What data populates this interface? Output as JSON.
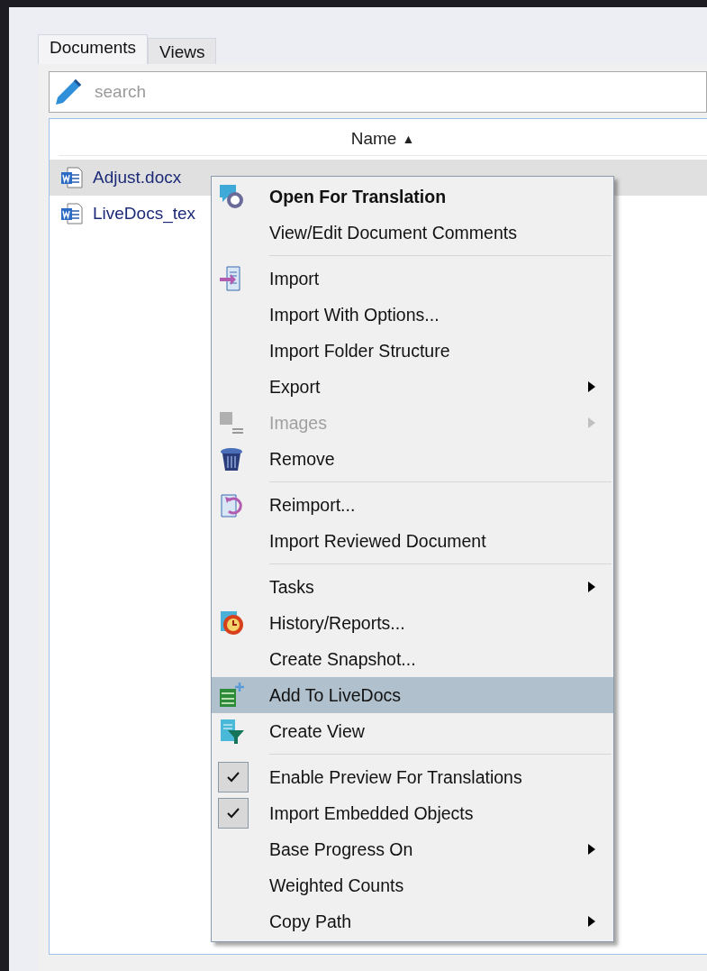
{
  "tabs": [
    {
      "label": "Documents",
      "selected": true
    },
    {
      "label": "Views",
      "selected": false
    }
  ],
  "search": {
    "placeholder": "search"
  },
  "table": {
    "columns": [
      {
        "label": "Name",
        "sort_glyph": "▲"
      }
    ],
    "rows": [
      {
        "name": "Adjust.docx",
        "selected": true
      },
      {
        "name": "LiveDocs_tex",
        "selected": false
      }
    ]
  },
  "context_menu": {
    "groups": [
      {
        "items": [
          {
            "label": "Open For Translation",
            "kind": "translate",
            "bold": true,
            "disabled": false,
            "submenu": false,
            "checked": false,
            "selected": false
          },
          {
            "label": "View/Edit Document Comments",
            "kind": "plain",
            "bold": false,
            "disabled": false,
            "submenu": false,
            "checked": false,
            "selected": false
          }
        ]
      },
      {
        "items": [
          {
            "label": "Import",
            "kind": "import",
            "bold": false,
            "disabled": false,
            "submenu": false,
            "checked": false,
            "selected": false
          },
          {
            "label": "Import With Options...",
            "kind": "plain",
            "bold": false,
            "disabled": false,
            "submenu": false,
            "checked": false,
            "selected": false
          },
          {
            "label": "Import Folder Structure",
            "kind": "plain",
            "bold": false,
            "disabled": false,
            "submenu": false,
            "checked": false,
            "selected": false
          },
          {
            "label": "Export",
            "kind": "plain",
            "bold": false,
            "disabled": false,
            "submenu": true,
            "checked": false,
            "selected": false
          },
          {
            "label": "Images",
            "kind": "images",
            "bold": false,
            "disabled": true,
            "submenu": true,
            "checked": false,
            "selected": false
          },
          {
            "label": "Remove",
            "kind": "remove",
            "bold": false,
            "disabled": false,
            "submenu": false,
            "checked": false,
            "selected": false
          }
        ]
      },
      {
        "items": [
          {
            "label": "Reimport...",
            "kind": "reimport",
            "bold": false,
            "disabled": false,
            "submenu": false,
            "checked": false,
            "selected": false
          },
          {
            "label": "Import Reviewed Document",
            "kind": "plain",
            "bold": false,
            "disabled": false,
            "submenu": false,
            "checked": false,
            "selected": false
          }
        ]
      },
      {
        "items": [
          {
            "label": "Tasks",
            "kind": "plain",
            "bold": false,
            "disabled": false,
            "submenu": true,
            "checked": false,
            "selected": false
          },
          {
            "label": "History/Reports...",
            "kind": "history",
            "bold": false,
            "disabled": false,
            "submenu": false,
            "checked": false,
            "selected": false
          },
          {
            "label": "Create Snapshot...",
            "kind": "plain",
            "bold": false,
            "disabled": false,
            "submenu": false,
            "checked": false,
            "selected": false
          },
          {
            "label": "Add To LiveDocs",
            "kind": "livedocs",
            "bold": false,
            "disabled": false,
            "submenu": false,
            "checked": false,
            "selected": true
          },
          {
            "label": "Create View",
            "kind": "view",
            "bold": false,
            "disabled": false,
            "submenu": false,
            "checked": false,
            "selected": false
          }
        ]
      },
      {
        "items": [
          {
            "label": "Enable Preview For Translations",
            "kind": "check",
            "bold": false,
            "disabled": false,
            "submenu": false,
            "checked": true,
            "selected": false
          },
          {
            "label": "Import Embedded Objects",
            "kind": "check",
            "bold": false,
            "disabled": false,
            "submenu": false,
            "checked": true,
            "selected": false
          },
          {
            "label": "Base Progress On",
            "kind": "plain",
            "bold": false,
            "disabled": false,
            "submenu": true,
            "checked": false,
            "selected": false
          },
          {
            "label": "Weighted Counts",
            "kind": "plain",
            "bold": false,
            "disabled": false,
            "submenu": false,
            "checked": false,
            "selected": false
          },
          {
            "label": "Copy Path",
            "kind": "plain",
            "bold": false,
            "disabled": false,
            "submenu": true,
            "checked": false,
            "selected": false
          }
        ]
      }
    ]
  }
}
